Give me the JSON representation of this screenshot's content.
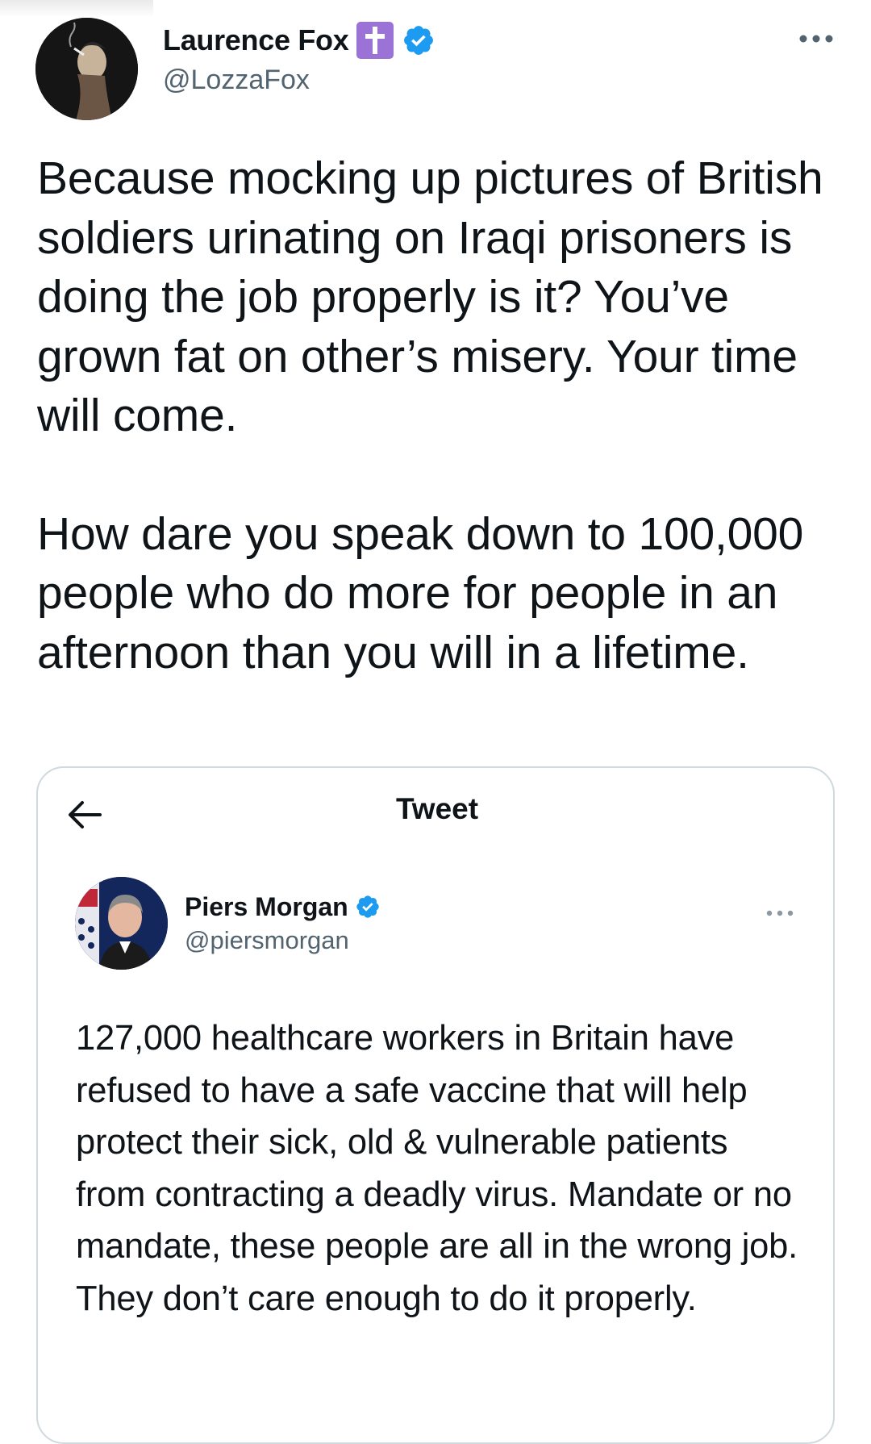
{
  "tweet": {
    "author": {
      "display_name": "Laurence Fox",
      "handle": "@LozzaFox",
      "badges": [
        "cross-icon",
        "verified-icon"
      ]
    },
    "paragraphs": [
      "Because mocking up pictures of British soldiers urinating on Iraqi prisoners is doing the job properly is it? You’ve grown fat on other’s misery. Your time will come.",
      "How dare you speak down to 100,000 people who do more for people in an afternoon than you will in a lifetime."
    ]
  },
  "quoted": {
    "header_title": "Tweet",
    "author": {
      "display_name": "Piers Morgan",
      "handle": "@piersmorgan"
    },
    "text": "127,000 healthcare workers in Britain have refused to have a safe vaccine that will help protect their sick, old & vulnerable patients from contracting a deadly virus. Mandate or no mandate, these people are all in the wrong job. They don’t care enough to do it properly."
  },
  "colors": {
    "text": "#0f1419",
    "secondary": "#536471",
    "verified": "#1d9bf0",
    "cross_badge": "#9b72d6",
    "border": "#cfd9de"
  }
}
